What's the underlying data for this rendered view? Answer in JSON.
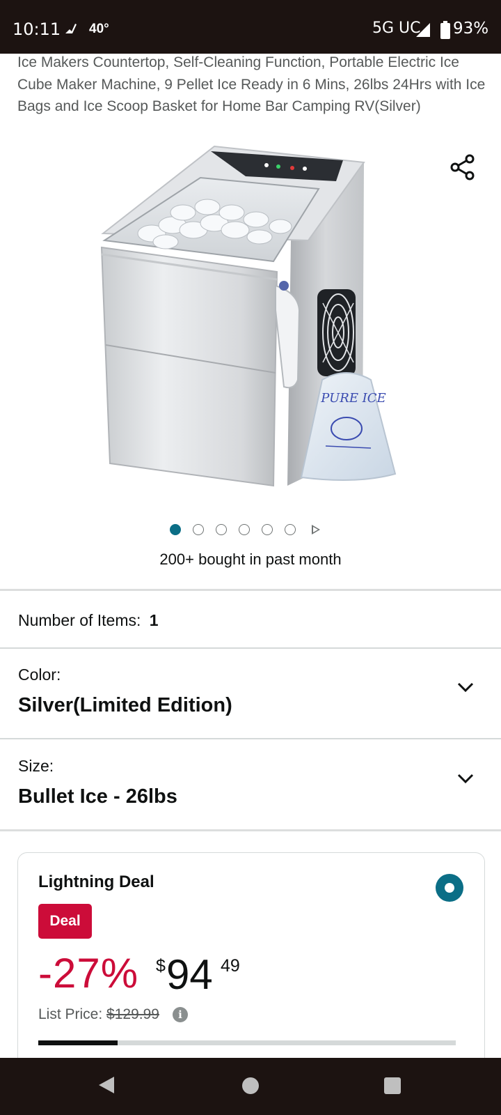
{
  "status": {
    "time": "10:11",
    "temperature": "40°",
    "network": "5G UC",
    "battery": "93%"
  },
  "product": {
    "title": "Ice Makers Countertop, Self-Cleaning Function, Portable Electric Ice Cube Maker Machine, 9 Pellet Ice Ready in 6 Mins, 26lbs 24Hrs with Ice Bags and Ice Scoop Basket for Home Bar Camping RV(Silver)",
    "bag_label": "PURE ICE",
    "carousel_count": 6,
    "carousel_active": 0,
    "bought_text": "200+ bought in past month"
  },
  "options": {
    "number_of_items_label": "Number of Items:",
    "number_of_items_value": "1",
    "color_label": "Color:",
    "color_value": "Silver(Limited Edition)",
    "size_label": "Size:",
    "size_value": "Bullet Ice - 26lbs"
  },
  "deal": {
    "title": "Lightning Deal",
    "badge": "Deal",
    "discount": "-27%",
    "currency": "$",
    "price_whole": "94",
    "price_fraction": "49",
    "list_price_label": "List Price:",
    "list_price_value": "$129.99",
    "claimed_fraction": 0.19
  },
  "colors": {
    "accent_teal": "#0b6e86",
    "deal_red": "#cc0c39",
    "bars": "#1c1311"
  },
  "icons": {
    "share": "share-icon",
    "chevron": "chevron-down-icon",
    "info": "info-icon",
    "back": "nav-back-icon",
    "home": "nav-home-icon",
    "recents": "nav-recents-icon"
  }
}
